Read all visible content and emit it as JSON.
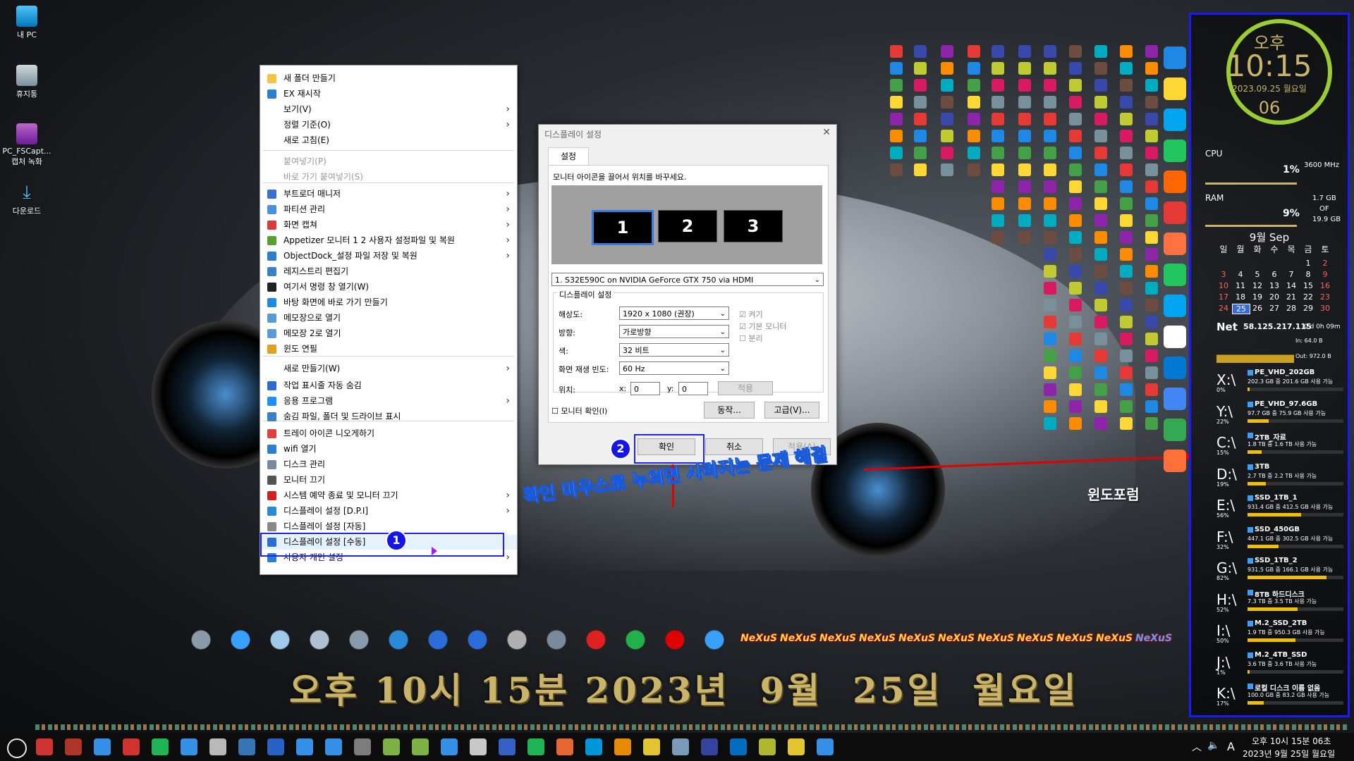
{
  "desktop_icons": [
    {
      "label": "내 PC",
      "icon": "monitor-icon"
    },
    {
      "label": "휴지통",
      "icon": "recycle-bin-icon"
    },
    {
      "label": "PC_FSCapt... 캡처 녹화",
      "icon": "video-file-icon"
    },
    {
      "label": "다운로드",
      "icon": "download-icon"
    }
  ],
  "context_menu": {
    "items": [
      {
        "label": "새 폴더 만들기",
        "icon": "folder-icon",
        "color": "#f5c542",
        "submenu": false,
        "disabled": false
      },
      {
        "label": "EX 재시작",
        "icon": "refresh-icon",
        "color": "#2a7fd4",
        "submenu": false,
        "disabled": false
      },
      {
        "label": "보기(V)",
        "icon": "",
        "color": "",
        "submenu": true,
        "disabled": false
      },
      {
        "label": "정렬 기준(O)",
        "icon": "",
        "color": "",
        "submenu": true,
        "disabled": false
      },
      {
        "label": "새로 고침(E)",
        "icon": "",
        "color": "",
        "submenu": false,
        "disabled": false
      },
      {
        "label": "붙여넣기(P)",
        "icon": "",
        "color": "",
        "submenu": false,
        "disabled": true
      },
      {
        "label": "바로 가기 붙여넣기(S)",
        "icon": "",
        "color": "",
        "submenu": false,
        "disabled": true
      },
      {
        "label": "부트로더 매니저",
        "icon": "bootloader-icon",
        "color": "#3b6fd8",
        "submenu": true,
        "disabled": false
      },
      {
        "label": "파티션 관리",
        "icon": "partition-icon",
        "color": "#4a90e2",
        "submenu": true,
        "disabled": false
      },
      {
        "label": "화면 캡쳐",
        "icon": "capture-icon",
        "color": "#d83b3b",
        "submenu": true,
        "disabled": false
      },
      {
        "label": "Appetizer 모니터 1  2 사용자 설정파일 및 복원",
        "icon": "appetizer-icon",
        "color": "#5aa02c",
        "submenu": true,
        "disabled": false
      },
      {
        "label": "ObjectDock_설정 파일 저장 및 복원",
        "icon": "objectdock-icon",
        "color": "#2c7fd0",
        "submenu": true,
        "disabled": false
      },
      {
        "label": "레지스트리 편집기",
        "icon": "registry-icon",
        "color": "#3a80c8",
        "submenu": false,
        "disabled": false
      },
      {
        "label": "여기서 명령 창 열기(W)",
        "icon": "cmd-icon",
        "color": "#222222",
        "submenu": false,
        "disabled": false
      },
      {
        "label": "바탕 화면에 바로 가기 만들기",
        "icon": "shortcut-icon",
        "color": "#1e88e5",
        "submenu": false,
        "disabled": false
      },
      {
        "label": "메모장으로 열기",
        "icon": "notepad-icon",
        "color": "#5b9bd5",
        "submenu": false,
        "disabled": false
      },
      {
        "label": "메모장 2로 열기",
        "icon": "notepad2-icon",
        "color": "#5b9bd5",
        "submenu": false,
        "disabled": false
      },
      {
        "label": "윈도 연필",
        "icon": "pencil-icon",
        "color": "#e0a020",
        "submenu": false,
        "disabled": false
      },
      {
        "label": "새로 만들기(W)",
        "icon": "",
        "color": "",
        "submenu": true,
        "disabled": false
      },
      {
        "label": "작업 표시줄 자동 숨김",
        "icon": "taskbar-icon",
        "color": "#2b6cd3",
        "submenu": false,
        "disabled": false
      },
      {
        "label": "응용 프로그램",
        "icon": "apps-icon",
        "color": "#1e90ff",
        "submenu": true,
        "disabled": false
      },
      {
        "label": "숨김 파일, 폴더 및 드라이브 표시",
        "icon": "hidden-files-icon",
        "color": "#3a80c8",
        "submenu": false,
        "disabled": false
      },
      {
        "label": "트레이 아이콘 니오게하기",
        "icon": "check-icon",
        "color": "#e04040",
        "submenu": false,
        "disabled": false
      },
      {
        "label": "wifi 열기",
        "icon": "wifi-icon",
        "color": "#2a7fd4",
        "submenu": false,
        "disabled": false
      },
      {
        "label": "디스크 관리",
        "icon": "disk-icon",
        "color": "#7a8a9a",
        "submenu": false,
        "disabled": false
      },
      {
        "label": "모니터 끄기",
        "icon": "monitor-off-icon",
        "color": "#555555",
        "submenu": false,
        "disabled": false
      },
      {
        "label": "시스템 예약 종료 및 모니터 끄기",
        "icon": "shutdown-icon",
        "color": "#d02020",
        "submenu": true,
        "disabled": false
      },
      {
        "label": "디스플레이 설정 [D.P.I]",
        "icon": "display-icon",
        "color": "#2a8ad8",
        "submenu": true,
        "disabled": false
      },
      {
        "label": "디스플레이 설정 [자동]",
        "icon": "display-auto-icon",
        "color": "#888888",
        "submenu": false,
        "disabled": false
      },
      {
        "label": "디스플레이 설정 [수동]",
        "icon": "display-manual-icon",
        "color": "#2a6cd8",
        "submenu": false,
        "disabled": false
      },
      {
        "label": "사용자 개인 설정",
        "icon": "personalize-icon",
        "color": "#2a7fd4",
        "submenu": true,
        "disabled": false
      }
    ]
  },
  "dialog": {
    "title": "디스플레이 설정",
    "tab": "설정",
    "instruction": "모니터 아이콘을 끌어서 위치를 바꾸세요.",
    "monitors": [
      "1",
      "2",
      "3"
    ],
    "monitor_select": "1. S32E590C on NVIDIA GeForce GTX 750 via HDMI",
    "group_title": "디스플레이 설정",
    "resolution_label": "해상도:",
    "resolution": "1920 x 1080 (권장)",
    "orientation_label": "방향:",
    "orientation": "가로방향",
    "color_label": "색:",
    "color": "32 비트",
    "refresh_label": "화면 재생 빈도:",
    "refresh": "60 Hz",
    "position_label": "위치:",
    "x_label": "x:",
    "x_value": "0",
    "y_label": "y:",
    "y_value": "0",
    "apply_pos": "적용",
    "cb_on": "켜기",
    "cb_primary": "기본 모니터",
    "cb_separate": "분리",
    "identify": "모니터 확인(I)",
    "action_btn": "동작...",
    "advanced_btn": "고급(V)...",
    "ok": "확인",
    "cancel": "취소",
    "apply": "적용(A)"
  },
  "annotations": {
    "badge1": "1",
    "badge2": "2",
    "caption": "확인 마우스로 누의면 사라지는 문제 해결",
    "watermark": "윈도포럼"
  },
  "clock_widget": {
    "ampm": "오후",
    "time": "10:15",
    "date": "2023.09.25 월요일",
    "seconds": "06"
  },
  "system": {
    "cpu_label": "CPU",
    "cpu_pct": "1%",
    "cpu_freq": "3600 MHz",
    "ram_label": "RAM",
    "ram_pct": "9%",
    "ram_used": "1.7 GB",
    "ram_of": "OF",
    "ram_total": "19.9 GB"
  },
  "calendar": {
    "title": "9월 Sep",
    "weekdays": [
      "일",
      "월",
      "화",
      "수",
      "목",
      "금",
      "토"
    ],
    "weeks": [
      [
        "",
        "",
        "",
        "",
        "",
        "1",
        "2"
      ],
      [
        "3",
        "4",
        "5",
        "6",
        "7",
        "8",
        "9"
      ],
      [
        "10",
        "11",
        "12",
        "13",
        "14",
        "15",
        "16"
      ],
      [
        "17",
        "18",
        "19",
        "20",
        "21",
        "22",
        "23"
      ],
      [
        "24",
        "25",
        "26",
        "27",
        "28",
        "29",
        "30"
      ]
    ],
    "today": "25"
  },
  "net": {
    "label": "Net",
    "ip": "58.125.217.115",
    "uptime": "0 d 0h 09m",
    "in": "In: 64.0 B",
    "out": "Out: 972.0 B"
  },
  "drives": [
    {
      "letter": "X:\\",
      "pct": "0%",
      "name": "PE_VHD_202GB",
      "info": "202.3 GB 중  201.6 GB 사용 가능",
      "fill": 0.003
    },
    {
      "letter": "Y:\\",
      "pct": "22%",
      "name": "PE_VHD_97.6GB",
      "info": "97.7 GB 중   75.9 GB 사용 가능",
      "fill": 0.22
    },
    {
      "letter": "C:\\",
      "pct": "15%",
      "name": "2TB_자료",
      "info": "1.8 TB 중     1.6 TB 사용 가능",
      "fill": 0.15
    },
    {
      "letter": "D:\\",
      "pct": "19%",
      "name": "3TB",
      "info": "2.7 TB 중     2.2 TB 사용 가능",
      "fill": 0.19
    },
    {
      "letter": "E:\\",
      "pct": "56%",
      "name": "SSD_1TB_1",
      "info": "931.4 GB 중  412.5 GB 사용 가능",
      "fill": 0.56
    },
    {
      "letter": "F:\\",
      "pct": "32%",
      "name": "SSD_450GB",
      "info": "447.1 GB 중  302.5 GB 사용 가능",
      "fill": 0.32
    },
    {
      "letter": "G:\\",
      "pct": "82%",
      "name": "SSD_1TB_2",
      "info": "931.5 GB 중  166.1 GB 사용 가능",
      "fill": 0.82
    },
    {
      "letter": "H:\\",
      "pct": "52%",
      "name": "8TB 하드디스크",
      "info": "7.3 TB 중     3.5 TB 사용 가능",
      "fill": 0.52
    },
    {
      "letter": "I:\\",
      "pct": "50%",
      "name": "M.2_SSD_2TB",
      "info": "1.9 TB 중     950.3 GB 사용 가능",
      "fill": 0.5
    },
    {
      "letter": "J:\\",
      "pct": "1%",
      "name": "M.2_4TB_SSD",
      "info": "3.6 TB 중     3.6 TB 사용 가능",
      "fill": 0.01
    },
    {
      "letter": "K:\\",
      "pct": "17%",
      "name": "로컬 디스크 이름 없음",
      "info": "100.0 GB 중  83.2 GB 사용 가능",
      "fill": 0.17
    }
  ],
  "big_clock": "오후 10시 15분 2023년  9월  25일  월요일",
  "nexus_label": "NeXuS",
  "taskbar": {
    "time": "오후 10시 15분 06초",
    "date": "2023년  9월 25일 월요일",
    "ime": "A"
  },
  "colors": {
    "accent_blue": "#1a1aff",
    "gold": "#c9b46a",
    "clock_green": "#9acd32"
  }
}
